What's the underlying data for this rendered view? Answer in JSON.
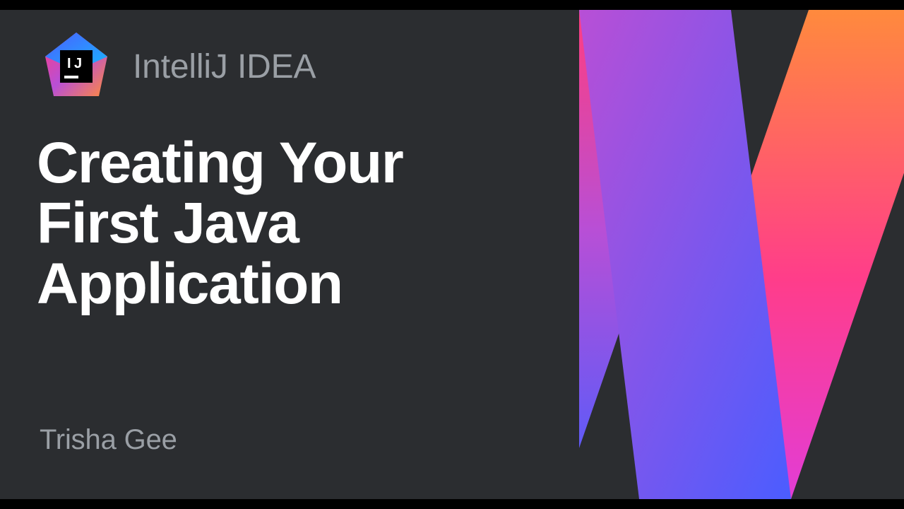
{
  "header": {
    "product": "IntelliJ IDEA",
    "logo_label": "IJ"
  },
  "title": {
    "line1": "Creating Your",
    "line2": "First Java",
    "line3": "Application"
  },
  "author": "Trisha Gee"
}
